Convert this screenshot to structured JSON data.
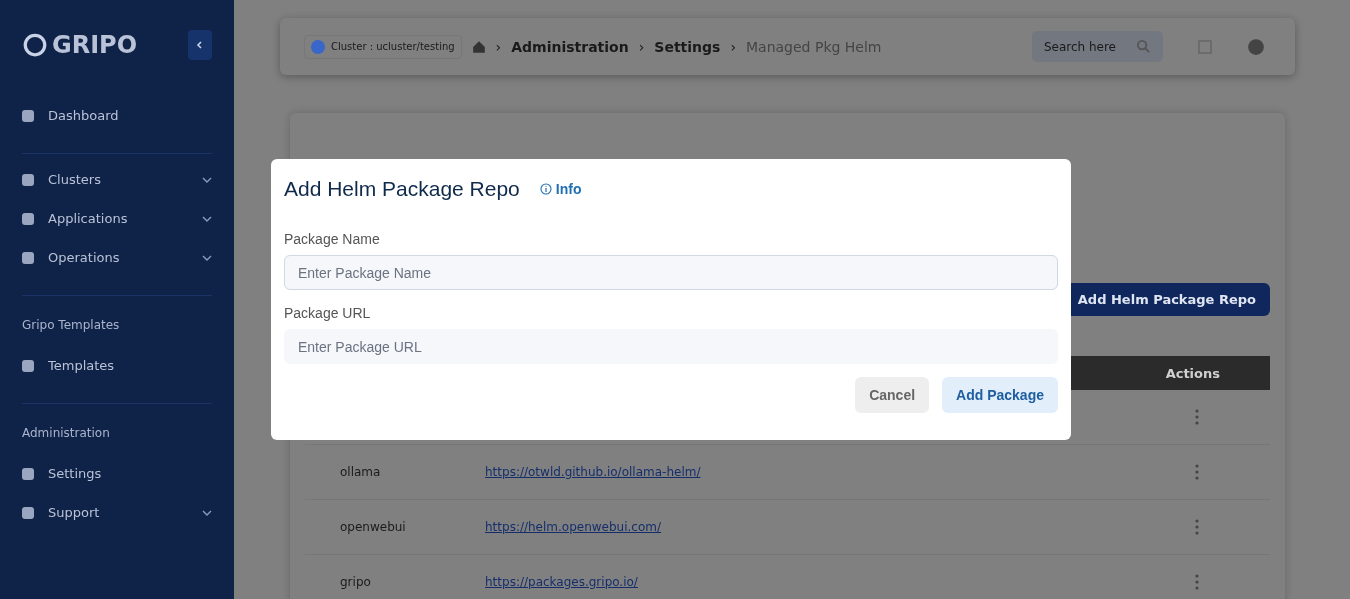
{
  "sidebar": {
    "logo": "GRIPO",
    "sections": [
      {
        "items": [
          {
            "label": "Dashboard",
            "expandable": false
          }
        ]
      },
      {
        "items": [
          {
            "label": "Clusters",
            "expandable": true
          },
          {
            "label": "Applications",
            "expandable": true
          },
          {
            "label": "Operations",
            "expandable": true
          }
        ]
      },
      {
        "heading": "Gripo Templates",
        "items": [
          {
            "label": "Templates",
            "expandable": false
          }
        ]
      },
      {
        "heading": "Administration",
        "items": [
          {
            "label": "Settings",
            "expandable": false
          },
          {
            "label": "Support",
            "expandable": true
          }
        ]
      }
    ]
  },
  "topbar": {
    "cluster_select": "Cluster : ucluster/testing",
    "breadcrumb": [
      "Administration",
      "Settings",
      "Managed Pkg Helm"
    ],
    "separator": "›",
    "search": {
      "placeholder": "Search here"
    }
  },
  "page": {
    "add_button": "Add Helm Package Repo",
    "table": {
      "actions_column": "Actions",
      "rows": [
        {},
        {
          "name": "ollama",
          "url": "https://otwld.github.io/ollama-helm/"
        },
        {
          "name": "openwebui",
          "url": "https://helm.openwebui.com/"
        },
        {
          "name": "gripo",
          "url": "https://packages.gripo.io/"
        }
      ]
    }
  },
  "modal": {
    "title": "Add Helm Package Repo",
    "info_link": "Info",
    "fields": [
      {
        "label": "Package Name",
        "placeholder": "Enter Package Name",
        "focused": true
      },
      {
        "label": "Package URL",
        "placeholder": "Enter Package URL",
        "focused": false
      }
    ],
    "buttons": [
      {
        "label": "Cancel",
        "kind": "secondary"
      },
      {
        "label": "Add Package",
        "kind": "primary"
      }
    ]
  }
}
